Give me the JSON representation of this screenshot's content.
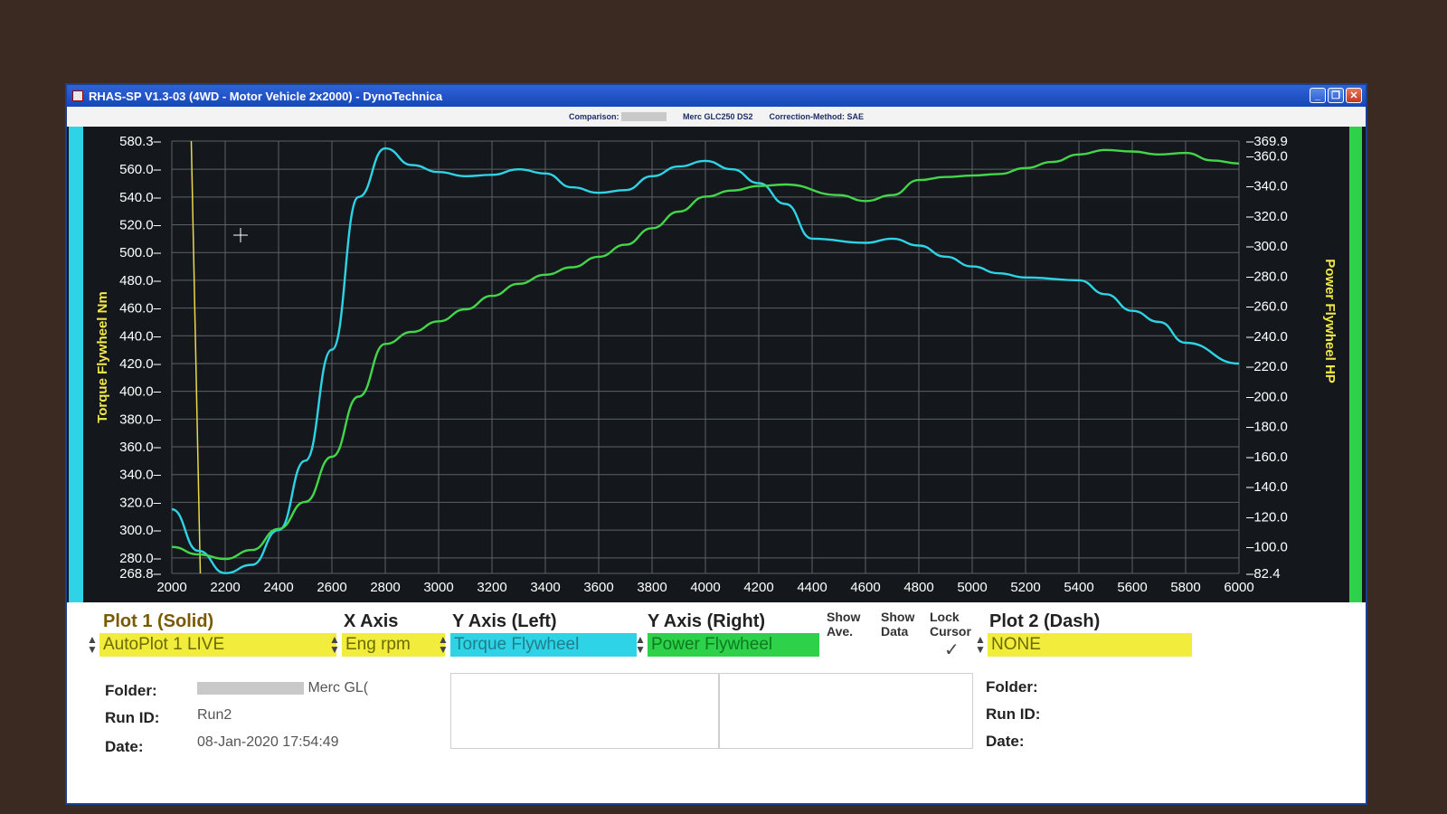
{
  "window": {
    "title": "RHAS-SP V1.3-03  (4WD - Motor Vehicle 2x2000) - DynoTechnica",
    "controls": {
      "minimize": "_",
      "restore": "❐",
      "close": "✕"
    }
  },
  "header_info": {
    "comparison_label": "Comparison:",
    "vehicle": "Merc GLC250 DS2",
    "correction": "Correction-Method: SAE"
  },
  "chart_data": {
    "type": "line",
    "x": [
      2000,
      2100,
      2200,
      2300,
      2400,
      2500,
      2600,
      2700,
      2800,
      2900,
      3000,
      3100,
      3200,
      3300,
      3400,
      3500,
      3600,
      3700,
      3800,
      3900,
      4000,
      4100,
      4200,
      4300,
      4400,
      4500,
      4600,
      4700,
      4800,
      4900,
      5000,
      5100,
      5200,
      5300,
      5400,
      5500,
      5600,
      5700,
      5800,
      5900,
      6000
    ],
    "series": [
      {
        "name": "Torque Flywheel",
        "axis": "left",
        "color": "#2fd3e6",
        "values": [
          315,
          285,
          269,
          275,
          300,
          350,
          430,
          540,
          575,
          563,
          558,
          555,
          556,
          560,
          557,
          547,
          543,
          545,
          555,
          562,
          566,
          560,
          550,
          535,
          510,
          507,
          510,
          505,
          497,
          490,
          485,
          482,
          480,
          470,
          458,
          450,
          435,
          420
        ],
        "x_override": [
          2000,
          2100,
          2200,
          2300,
          2400,
          2500,
          2600,
          2700,
          2800,
          2900,
          3000,
          3100,
          3200,
          3300,
          3400,
          3500,
          3600,
          3700,
          3800,
          3900,
          4000,
          4100,
          4200,
          4300,
          4400,
          4600,
          4700,
          4800,
          4900,
          5000,
          5100,
          5200,
          5400,
          5500,
          5600,
          5700,
          5800,
          6000
        ]
      },
      {
        "name": "Power Flywheel",
        "axis": "right",
        "color": "#44d64a",
        "values": [
          100,
          95,
          92,
          98,
          112,
          130,
          160,
          200,
          235,
          243,
          250,
          258,
          267,
          275,
          281,
          286,
          293,
          301,
          312,
          323,
          333,
          337,
          340,
          341,
          334,
          330,
          334,
          344,
          346,
          347,
          348,
          352,
          356,
          361,
          364,
          363,
          361,
          362,
          357,
          355
        ],
        "x_override": [
          2000,
          2100,
          2200,
          2300,
          2400,
          2500,
          2600,
          2700,
          2800,
          2900,
          3000,
          3100,
          3200,
          3300,
          3400,
          3500,
          3600,
          3700,
          3800,
          3900,
          4000,
          4100,
          4200,
          4300,
          4500,
          4600,
          4700,
          4800,
          4900,
          5000,
          5100,
          5200,
          5300,
          5400,
          5500,
          5600,
          5700,
          5800,
          5900,
          6000
        ]
      }
    ],
    "xlim": [
      2000,
      6000
    ],
    "xticks": [
      "2000",
      "2200",
      "2400",
      "2600",
      "2800",
      "3000",
      "3200",
      "3400",
      "3600",
      "3800",
      "4000",
      "4200",
      "4400",
      "4600",
      "4800",
      "5000",
      "5200",
      "5400",
      "5600",
      "5800",
      "6000"
    ],
    "ylim_left": [
      268.8,
      580.3
    ],
    "yticks_left": [
      "580.3",
      "560.0",
      "540.0",
      "520.0",
      "500.0",
      "480.0",
      "460.0",
      "440.0",
      "420.0",
      "400.0",
      "380.0",
      "360.0",
      "340.0",
      "320.0",
      "300.0",
      "280.0",
      "268.8"
    ],
    "ylim_right": [
      82.4,
      369.9
    ],
    "yticks_right": [
      "369.9",
      "360.0",
      "340.0",
      "320.0",
      "300.0",
      "280.0",
      "260.0",
      "240.0",
      "220.0",
      "200.0",
      "180.0",
      "160.0",
      "140.0",
      "120.0",
      "100.0",
      "82.4"
    ],
    "ylabel_left": "Torque Flywheel Nm",
    "ylabel_right": "Power Flywheel HP",
    "cursor_x": 2100,
    "grid": true,
    "colors": {
      "background": "#14181c",
      "grid": "#5a6266",
      "tick_text": "#ffffff",
      "axis_label": "#f2e84a",
      "cursor": "#e8d84a"
    }
  },
  "controls": {
    "plot1_header": "Plot 1 (Solid)",
    "xaxis_header": "X Axis",
    "yleft_header": "Y Axis (Left)",
    "yright_header": "Y Axis (Right)",
    "show_ave_header": "Show\nAve.",
    "show_data_header": "Show\nData",
    "lock_cursor_header": "Lock\nCursor",
    "plot2_header": "Plot 2 (Dash)",
    "plot1_value": "AutoPlot 1 LIVE",
    "xaxis_value": "Eng rpm",
    "yleft_value": "Torque Flywheel",
    "yright_value": "Power Flywheel",
    "plot2_value": "NONE",
    "check_mark": "✓",
    "colors": {
      "yellow": "#f2ec3c",
      "cyan": "#2fd3e6",
      "green": "#2ed14a"
    }
  },
  "plot1_info": {
    "folder_label": "Folder:",
    "folder_value": "Merc GL(",
    "runid_label": "Run ID:",
    "runid_value": "Run2",
    "date_label": "Date:",
    "date_value": "08-Jan-2020  17:54:49"
  },
  "plot2_info": {
    "folder_label": "Folder:",
    "runid_label": "Run ID:",
    "date_label": "Date:"
  }
}
